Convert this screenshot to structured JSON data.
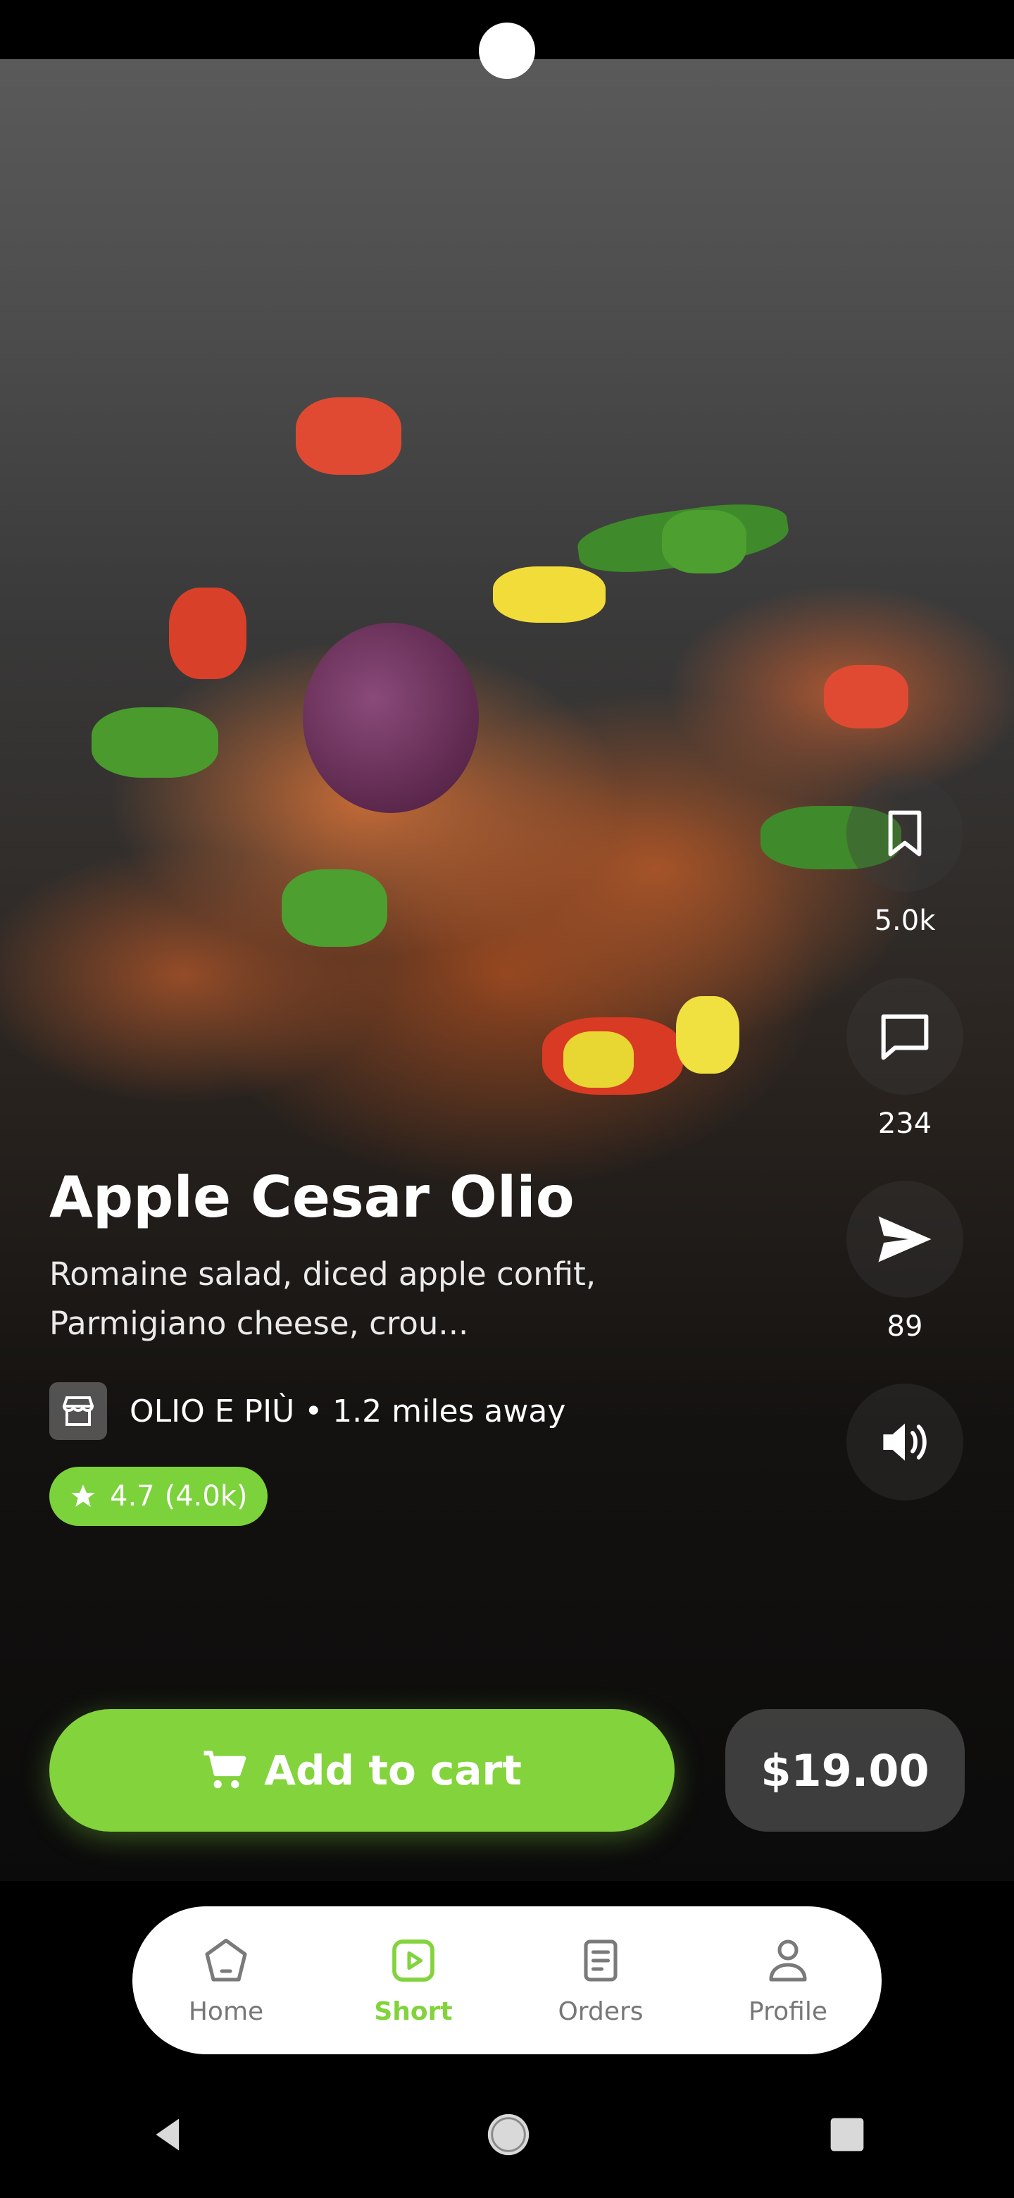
{
  "video": {
    "description_label": "food-video"
  },
  "actions": {
    "bookmark_count": "5.0k",
    "comment_count": "234",
    "share_count": "89"
  },
  "dish": {
    "title": "Apple Cesar Olio",
    "description": "Romaine salad, diced apple confit, Parmigiano cheese, crou...",
    "store_line": "OLIO E PIÙ • 1.2 miles away",
    "rating": "4.7",
    "rating_count": "(4.0k)"
  },
  "cta": {
    "add_to_cart": "Add to cart",
    "price": "$19.00"
  },
  "tabs": [
    {
      "label": "Home",
      "icon": "home-icon"
    },
    {
      "label": "Short",
      "icon": "play-icon"
    },
    {
      "label": "Orders",
      "icon": "orders-icon"
    },
    {
      "label": "Profile",
      "icon": "profile-icon"
    }
  ],
  "colors": {
    "accent": "#82d33c",
    "rating_pill": "#7bd23a"
  }
}
